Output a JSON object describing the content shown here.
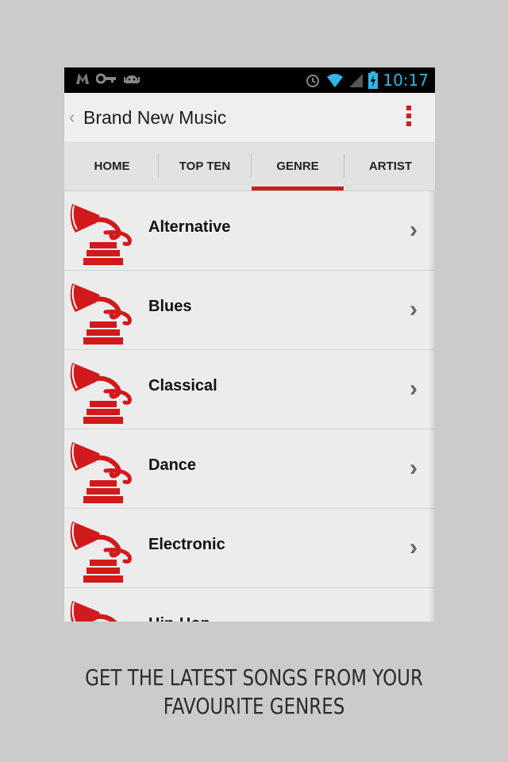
{
  "status_bar": {
    "time": "10:17",
    "left_icons": [
      "gmail-icon",
      "key-icon",
      "android-icon"
    ],
    "right_icons": [
      "alarm-icon",
      "wifi-icon",
      "signal-icon",
      "battery-charging-icon"
    ],
    "accent": "#33b5e5"
  },
  "action_bar": {
    "title": "Brand New Music",
    "back_icon": "chevron-left-icon",
    "menu_icon": "overflow-menu-icon",
    "menu_color": "#d2191b"
  },
  "tabs": [
    {
      "label": "HOME",
      "selected": false
    },
    {
      "label": "TOP TEN",
      "selected": false
    },
    {
      "label": "GENRE",
      "selected": true
    },
    {
      "label": "ARTIST",
      "selected": false
    }
  ],
  "genres": [
    {
      "label": "Alternative",
      "icon": "gramophone-icon"
    },
    {
      "label": "Blues",
      "icon": "gramophone-icon"
    },
    {
      "label": "Classical",
      "icon": "gramophone-icon"
    },
    {
      "label": "Dance",
      "icon": "gramophone-icon"
    },
    {
      "label": "Electronic",
      "icon": "gramophone-icon"
    },
    {
      "label": "Hip-Hop",
      "icon": "gramophone-icon"
    }
  ],
  "chevron": "›",
  "caption": {
    "line1": "GET THE LATEST SONGS FROM YOUR",
    "line2": "FAVOURITE GENRES"
  },
  "colors": {
    "brand_red": "#d2191b",
    "background": "#cbcbcb"
  }
}
